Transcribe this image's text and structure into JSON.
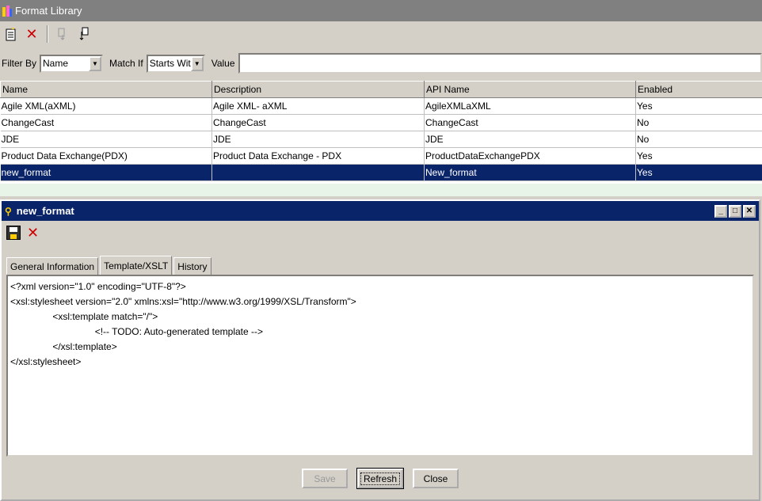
{
  "app": {
    "title": "Format Library"
  },
  "toolbar": {
    "icons": [
      "new-icon",
      "delete-icon",
      "export-icon",
      "import-icon"
    ]
  },
  "filter": {
    "filter_by_label": "Filter By",
    "filter_by_value": "Name",
    "match_if_label": "Match If",
    "match_if_value": "Starts With",
    "value_label": "Value",
    "value_text": ""
  },
  "grid": {
    "columns": [
      "Name",
      "Description",
      "API Name",
      "Enabled"
    ],
    "rows": [
      {
        "name": "Agile XML(aXML)",
        "description": "Agile XML- aXML",
        "api_name": "AgileXMLaXML",
        "enabled": "Yes"
      },
      {
        "name": "ChangeCast",
        "description": "ChangeCast",
        "api_name": "ChangeCast",
        "enabled": "No"
      },
      {
        "name": "JDE",
        "description": "JDE",
        "api_name": "JDE",
        "enabled": "No"
      },
      {
        "name": "Product Data Exchange(PDX)",
        "description": "Product Data Exchange - PDX",
        "api_name": "ProductDataExchangePDX",
        "enabled": "Yes"
      },
      {
        "name": "new_format",
        "description": "",
        "api_name": "New_format",
        "enabled": "Yes"
      }
    ],
    "selected_index": 4
  },
  "detail": {
    "title": "new_format",
    "tabs": [
      {
        "label": "General Information"
      },
      {
        "label": "Template/XSLT"
      },
      {
        "label": "History"
      }
    ],
    "active_tab": 1,
    "editor_lines": [
      "<?xml version=\"1.0\" encoding=\"UTF-8\"?>",
      "<xsl:stylesheet version=\"2.0\" xmlns:xsl=\"http://www.w3.org/1999/XSL/Transform\">",
      "                <xsl:template match=\"/\">",
      "                                <!-- TODO: Auto-generated template -->",
      "                </xsl:template>",
      "</xsl:stylesheet>"
    ],
    "buttons": {
      "save": "Save",
      "refresh": "Refresh",
      "close": "Close"
    }
  },
  "colors": {
    "selection": "#0a246a",
    "window_bg": "#d4d0c8",
    "delete_red": "#cc0000"
  }
}
